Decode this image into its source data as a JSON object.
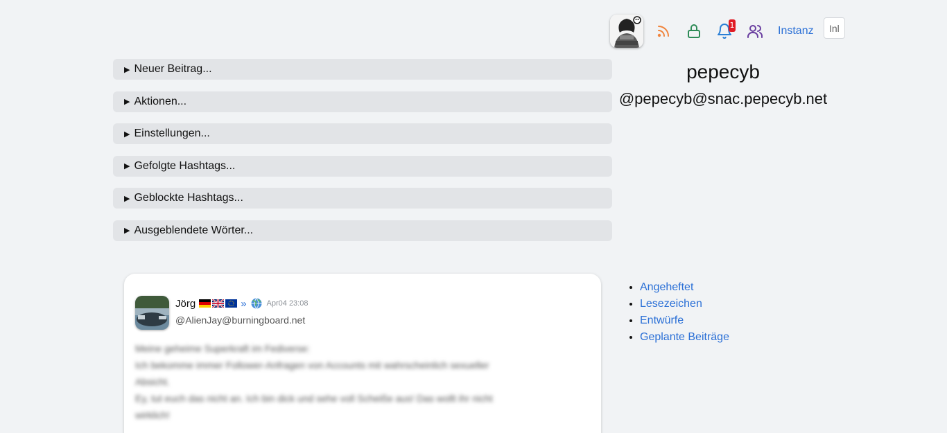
{
  "topbar": {
    "notification_count": "1",
    "instanz_label": "Instanz",
    "inline_input_value": "Inl"
  },
  "profile": {
    "name": "pepecyb",
    "handle": "@pepecyb@snac.pepecyb.net"
  },
  "sections": [
    {
      "label": "Neuer Beitrag..."
    },
    {
      "label": "Aktionen..."
    },
    {
      "label": "Einstellungen..."
    },
    {
      "label": "Gefolgte Hashtags..."
    },
    {
      "label": "Geblockte Hashtags..."
    },
    {
      "label": "Ausgeblendete Wörter..."
    }
  ],
  "post": {
    "author": "Jörg",
    "flags": [
      "de-flag-icon",
      "uk-flag-icon",
      "eu-flag-icon"
    ],
    "separator": "»",
    "date": "Apr04 23:08",
    "handle": "@AlienJay@burningboard.net",
    "body_lines": [
      "Meine geheime Superkraft im Fediverse:",
      "Ich bekomme immer Follower-Anfragen von Accounts mit wahrscheinlich sexueller",
      "Absicht.",
      "Ey, tut euch das nicht an. Ich bin dick und sehe voll Scheiße aus! Das wollt ihr nicht",
      "wirklich!"
    ]
  },
  "side_links": [
    {
      "label": "Angeheftet"
    },
    {
      "label": "Lesezeichen"
    },
    {
      "label": "Entwürfe"
    },
    {
      "label": "Geplante Beiträge"
    }
  ],
  "colors": {
    "link": "#2a6fd6",
    "rss": "#f0843c",
    "lock": "#2e8b57",
    "bell": "#2a7fd6",
    "people": "#6a3fa0",
    "badge": "#e01b24"
  }
}
